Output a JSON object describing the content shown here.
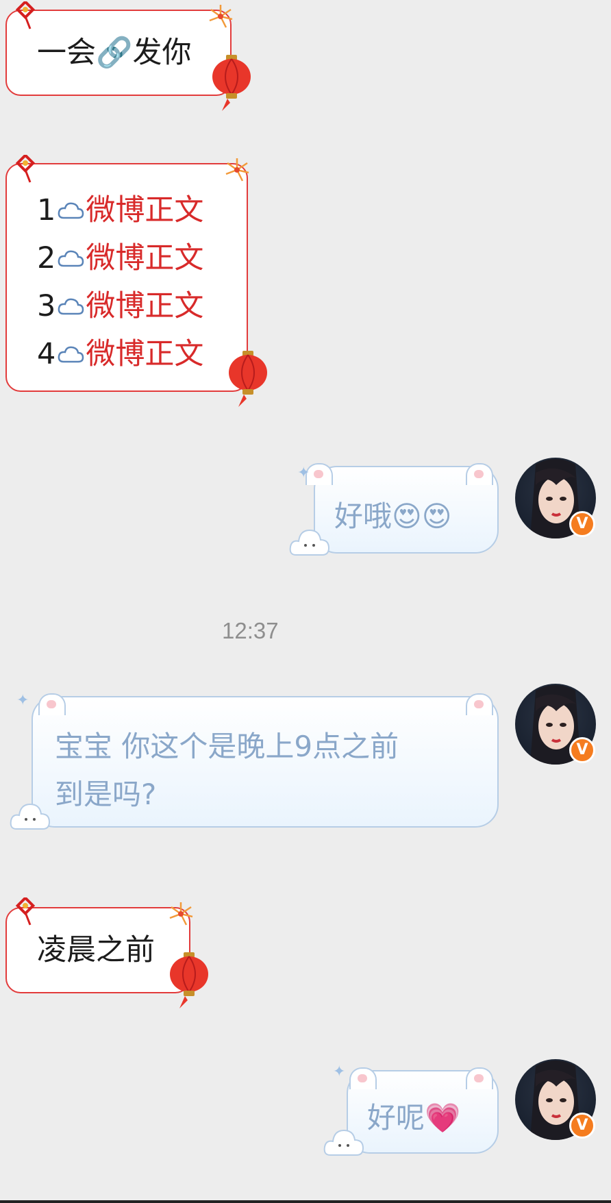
{
  "messages": [
    {
      "side": "left",
      "text": "一会🔗发你"
    },
    {
      "side": "left",
      "lines": [
        {
          "num": "1",
          "link": "微博正文"
        },
        {
          "num": "2",
          "link": "微博正文"
        },
        {
          "num": "3",
          "link": "微博正文"
        },
        {
          "num": "4",
          "link": "微博正文"
        }
      ]
    },
    {
      "side": "right",
      "text": "好哦😍😍"
    },
    {
      "side": "system",
      "text": "12:37"
    },
    {
      "side": "right",
      "line1": "宝宝 你这个是晚上9点之前",
      "line2": "到是吗?"
    },
    {
      "side": "left",
      "text": "凌晨之前"
    },
    {
      "side": "right",
      "text": "好呢💗"
    }
  ],
  "colors": {
    "background": "#ededed",
    "left_border": "#e23b3b",
    "link_red": "#d82a2a",
    "right_text": "#8aa7c9",
    "verified_badge": "#f57c1f"
  },
  "icons": {
    "verified_badge_label": "V"
  }
}
